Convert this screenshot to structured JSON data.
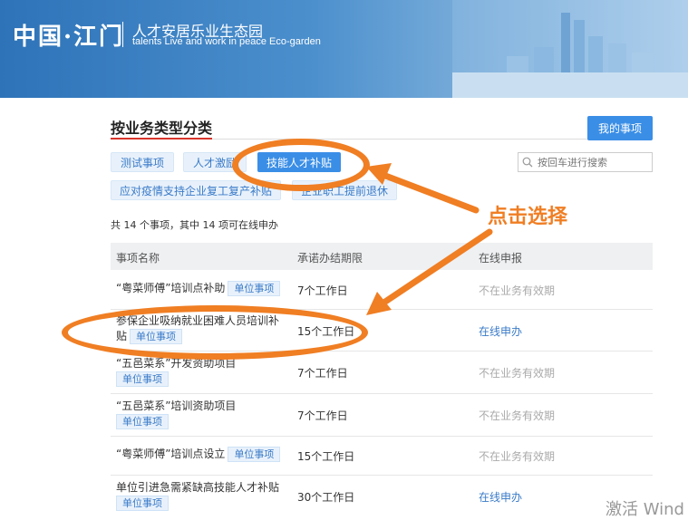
{
  "header": {
    "logo": "中国·江门",
    "slogan_cn": "人才安居乐业生态园",
    "slogan_en": "talents Live and work in peace Eco-garden"
  },
  "section": {
    "title": "按业务类型分类",
    "my_items_button": "我的事项"
  },
  "categories": [
    {
      "label": "测试事项",
      "active": false
    },
    {
      "label": "人才激励",
      "active": false
    },
    {
      "label": "技能人才补贴",
      "active": true
    },
    {
      "label": "应对疫情支持企业复工复产补贴",
      "active": false
    },
    {
      "label": "企业职工提前退休",
      "active": false
    }
  ],
  "search": {
    "placeholder": "按回车进行搜索"
  },
  "summary": "共 14 个事项，其中 14 项可在线申办",
  "table": {
    "headers": [
      "事项名称",
      "承诺办结期限",
      "在线申报"
    ],
    "rows": [
      {
        "name": "“粤菜师傅”培训点补助",
        "tag": "单位事项",
        "limit": "7个工作日",
        "online": "不在业务有效期"
      },
      {
        "name": "参保企业吸纳就业困难人员培训补贴",
        "tag": "单位事项",
        "limit": "15个工作日",
        "online": "在线申办"
      },
      {
        "name": "“五邑菜系”开发资助项目",
        "tag": "单位事项",
        "limit": "7个工作日",
        "online": "不在业务有效期"
      },
      {
        "name": "“五邑菜系”培训资助项目",
        "tag": "单位事项",
        "limit": "7个工作日",
        "online": "不在业务有效期"
      },
      {
        "name": "“粤菜师傅”培训点设立",
        "tag": "单位事项",
        "limit": "15个工作日",
        "online": "不在业务有效期"
      },
      {
        "name": "单位引进急需紧缺高技能人才补贴",
        "tag": "单位事项",
        "limit": "30个工作日",
        "online": "在线申办"
      }
    ]
  },
  "annotation": "点击选择",
  "watermark": "激活 Wind",
  "colors": {
    "accent": "#3a8ee6",
    "annotation": "#f07e23",
    "title_underline": "#d9342b"
  }
}
